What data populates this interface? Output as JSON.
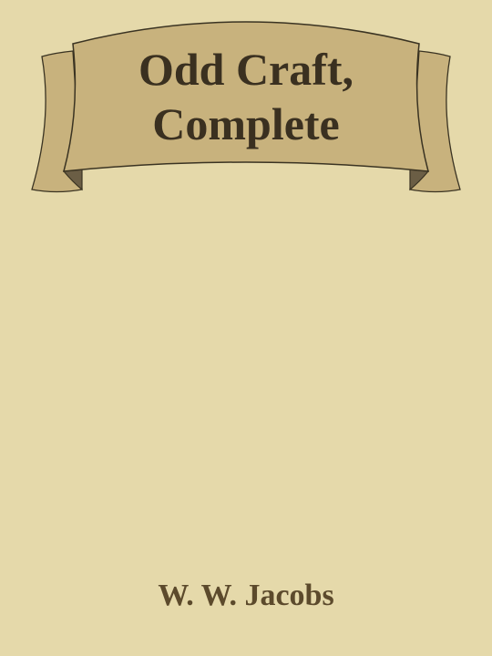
{
  "book": {
    "title_line_1": "Odd Craft,",
    "title_line_2": "Complete",
    "author": "W. W. Jacobs"
  },
  "colors": {
    "background": "#e5d9aa",
    "banner_fill": "#c8b27d",
    "banner_fold": "#6b5e45",
    "banner_outline": "#3a3322",
    "title_text": "#3a3020",
    "author_text": "#5c4a2c"
  }
}
